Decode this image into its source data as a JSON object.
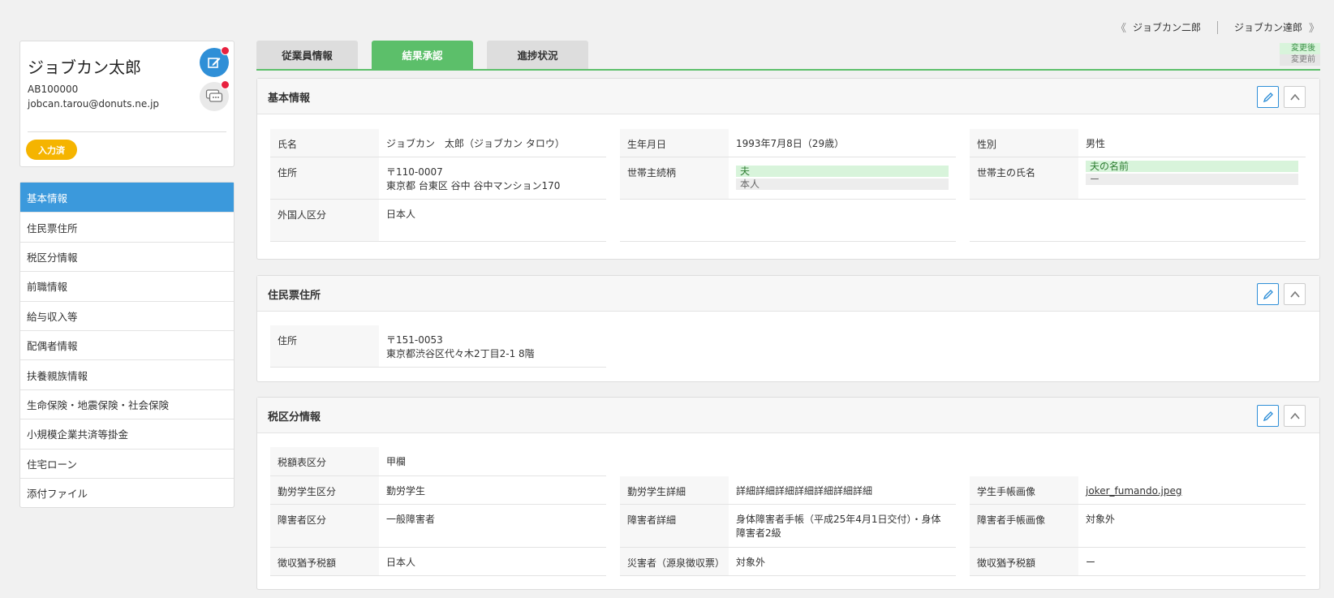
{
  "topnav": {
    "prev_arrow": "《",
    "prev_label": "ジョブカン二郎",
    "next_label": "ジョブカン達郎",
    "next_arrow": "》"
  },
  "profile": {
    "name": "ジョブカン太郎",
    "employee_id": "AB100000",
    "email": "jobcan.tarou@donuts.ne.jp",
    "status_badge": "入力済"
  },
  "sidebar": {
    "items": [
      {
        "label": "基本情報",
        "active": true
      },
      {
        "label": "住民票住所"
      },
      {
        "label": "税区分情報"
      },
      {
        "label": "前職情報"
      },
      {
        "label": "給与収入等"
      },
      {
        "label": "配偶者情報"
      },
      {
        "label": "扶養親族情報"
      },
      {
        "label": "生命保険・地震保険・社会保険"
      },
      {
        "label": "小規模企業共済等掛金"
      },
      {
        "label": "住宅ローン"
      },
      {
        "label": "添付ファイル"
      }
    ]
  },
  "tabs": [
    {
      "label": "従業員情報"
    },
    {
      "label": "結果承認",
      "active": true
    },
    {
      "label": "進捗状況"
    }
  ],
  "legend": {
    "after": "変更後",
    "before": "変更前"
  },
  "colors": {
    "accent_green": "#5cbf6a",
    "accent_blue": "#3b99dc",
    "badge_yellow": "#f5b400",
    "alert_red": "#e8213f"
  },
  "basic": {
    "title": "基本情報",
    "name_label": "氏名",
    "name_value": "ジョブカン　太郎（ジョブカン タロウ）",
    "birth_label": "生年月日",
    "birth_value": "1993年7月8日（29歳）",
    "gender_label": "性別",
    "gender_value": "男性",
    "address_label": "住所",
    "address_line1": "〒110-0007",
    "address_line2": "東京都 台東区 谷中 谷中マンション170",
    "relation_label": "世帯主続柄",
    "relation_after": "夫",
    "relation_before": "本人",
    "head_label": "世帯主の氏名",
    "head_after": "夫の名前",
    "head_before": "ー",
    "foreign_label": "外国人区分",
    "foreign_value": "日本人"
  },
  "resident": {
    "title": "住民票住所",
    "address_label": "住所",
    "address_line1": "〒151-0053",
    "address_line2": "東京都渋谷区代々木2丁目2-1 8階"
  },
  "tax": {
    "title": "税区分情報",
    "table_label": "税額表区分",
    "table_value": "甲欄",
    "student_label": "勤労学生区分",
    "student_value": "勤労学生",
    "student_detail_label": "勤労学生詳細",
    "student_detail_value": "詳細詳細詳細詳細詳細詳細詳細",
    "student_image_label": "学生手帳画像",
    "student_image_value": "joker_fumando.jpeg",
    "disability_label": "障害者区分",
    "disability_value": "一般障害者",
    "disability_detail_label": "障害者詳細",
    "disability_detail_value": "身体障害者手帳（平成25年4月1日交付）・身体障害者2級",
    "disability_image_label": "障害者手帳画像",
    "disability_image_value": "対象外",
    "deferral_label": "徴収猶予税額",
    "deferral_value": "日本人",
    "disaster_label": "災害者（源泉徴収票）",
    "disaster_value": "対象外",
    "deferral2_label": "徴収猶予税額",
    "deferral2_value": "ー"
  }
}
